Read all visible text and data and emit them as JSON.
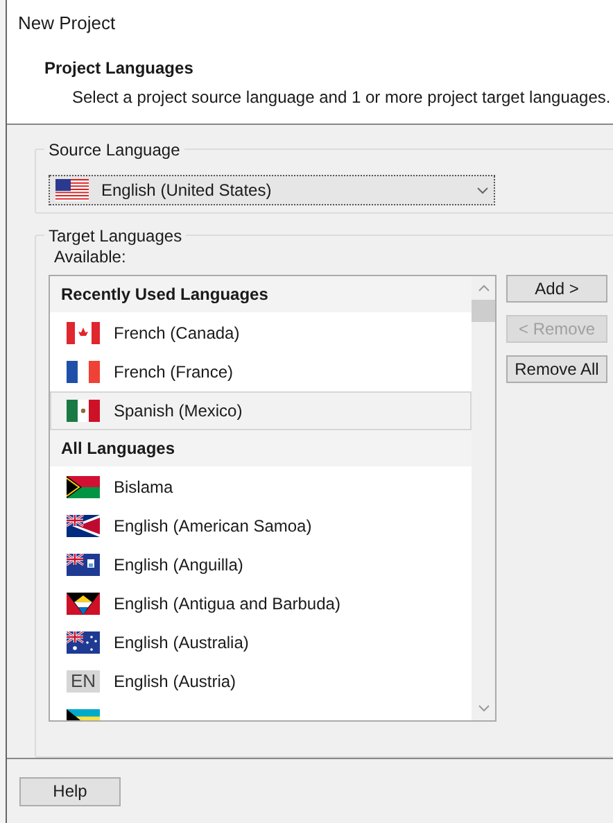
{
  "window": {
    "title": "New Project"
  },
  "header": {
    "title": "Project Languages",
    "subtitle": "Select a project source language and 1 or more project target languages."
  },
  "source_language": {
    "label": "Source Language",
    "value": "English (United States)",
    "kind": "us"
  },
  "target_languages": {
    "label": "Target Languages",
    "available_label": "Available:",
    "groups": [
      {
        "heading": "Recently Used Languages",
        "items": [
          {
            "name": "French (Canada)",
            "kind": "ca",
            "selected": false
          },
          {
            "name": "French (France)",
            "kind": "fr",
            "selected": false
          },
          {
            "name": "Spanish (Mexico)",
            "kind": "mx",
            "selected": true
          }
        ]
      },
      {
        "heading": "All Languages",
        "items": [
          {
            "name": "Bislama",
            "kind": "vu",
            "selected": false
          },
          {
            "name": "English (American Samoa)",
            "kind": "as",
            "selected": false
          },
          {
            "name": "English (Anguilla)",
            "kind": "ai",
            "selected": false
          },
          {
            "name": "English (Antigua and Barbuda)",
            "kind": "ag",
            "selected": false
          },
          {
            "name": "English (Australia)",
            "kind": "au",
            "selected": false
          },
          {
            "name": "English (Austria)",
            "kind": "text",
            "badge": "EN",
            "selected": false
          },
          {
            "kind": "bs",
            "selected": false
          }
        ]
      }
    ]
  },
  "buttons": [
    {
      "label": "Add >",
      "disabled": false
    },
    {
      "label": "< Remove",
      "disabled": true
    },
    {
      "label": "Remove All",
      "disabled": false
    }
  ],
  "footer_buttons": [
    {
      "label": "Help"
    }
  ]
}
